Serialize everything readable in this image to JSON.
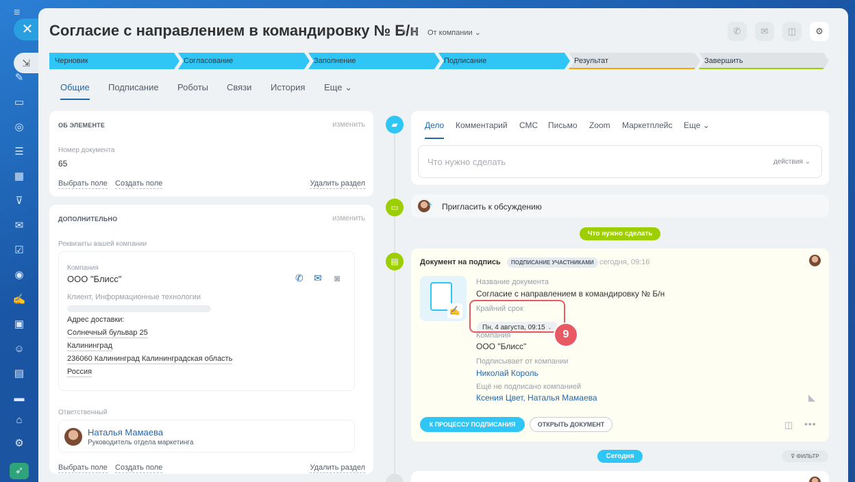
{
  "header": {
    "title": "Согласие с направлением в командировку № Б/н",
    "company_selector": "От компании"
  },
  "stages": [
    {
      "label": "Черновик",
      "state": "active"
    },
    {
      "label": "Согласование",
      "state": "active"
    },
    {
      "label": "Заполнение",
      "state": "active"
    },
    {
      "label": "Подписание",
      "state": "active"
    },
    {
      "label": "Результат",
      "state": "pending",
      "color": "#f7a700"
    },
    {
      "label": "Завершить",
      "state": "pending",
      "color": "#9dcf00"
    }
  ],
  "tabs": [
    "Общие",
    "Подписание",
    "Роботы",
    "Связи",
    "История",
    "Еще"
  ],
  "about": {
    "header": "ОБ ЭЛЕМЕНТЕ",
    "edit": "изменить",
    "doc_number_label": "Номер документа",
    "doc_number": "65",
    "select_field": "Выбрать поле",
    "create_field": "Создать поле",
    "delete_section": "Удалить раздел"
  },
  "extra": {
    "header": "ДОПОЛНИТЕЛЬНО",
    "edit": "изменить",
    "requisites_label": "Реквизиты вашей компании",
    "company_label": "Компания",
    "company_name": "ООО \"Блисс\"",
    "client_label": "Клиент, Информационные технологии",
    "address_label": "Адрес доставки:",
    "address_lines": [
      "Солнечный бульвар 25",
      "Калининград",
      "236060 Калининград Калининградская область",
      "Россия"
    ],
    "responsible_label": "Ответственный",
    "responsible_name": "Наталья Мамаева",
    "responsible_role": "Руководитель отдела маркетинга",
    "select_field": "Выбрать поле",
    "create_field": "Создать поле",
    "delete_section": "Удалить раздел"
  },
  "activity": {
    "tabs": [
      "Дело",
      "Комментарий",
      "СМС",
      "Письмо",
      "Zoom",
      "Маркетплейс",
      "Еще"
    ],
    "todo_placeholder": "Что нужно сделать",
    "actions": "действия",
    "invite": "Пригласить к обсуждению",
    "todo_pill": "Что нужно сделать"
  },
  "doc_card": {
    "title": "Документ на подпись",
    "badge": "ПОДПИСАНИЕ УЧАСТНИКАМИ",
    "time": "сегодня, 09:16",
    "name_label": "Название документа",
    "name": "Согласие с направлением в командировку № Б/н",
    "deadline_label": "Крайний срок",
    "deadline": "Пн, 4 августа, 09:15",
    "company_label": "Компания",
    "company": "ООО \"Блисс\"",
    "signer_label": "Подписывает от компании",
    "signer": "Николай Король",
    "not_signed_label": "Ещё не подписано компанией",
    "not_signed": "Ксения Цвет, Наталья Мамаева",
    "btn_process": "К ПРОЦЕССУ ПОДПИСАНИЯ",
    "btn_open": "ОТКРЫТЬ ДОКУМЕНТ"
  },
  "today_pill": "Сегодня",
  "filter": "ФИЛЬТР",
  "step_number": "9",
  "colors": {
    "accent": "#2fc6f6",
    "link": "#2067b0",
    "green": "#9dcf00",
    "highlight": "#e85a63"
  }
}
